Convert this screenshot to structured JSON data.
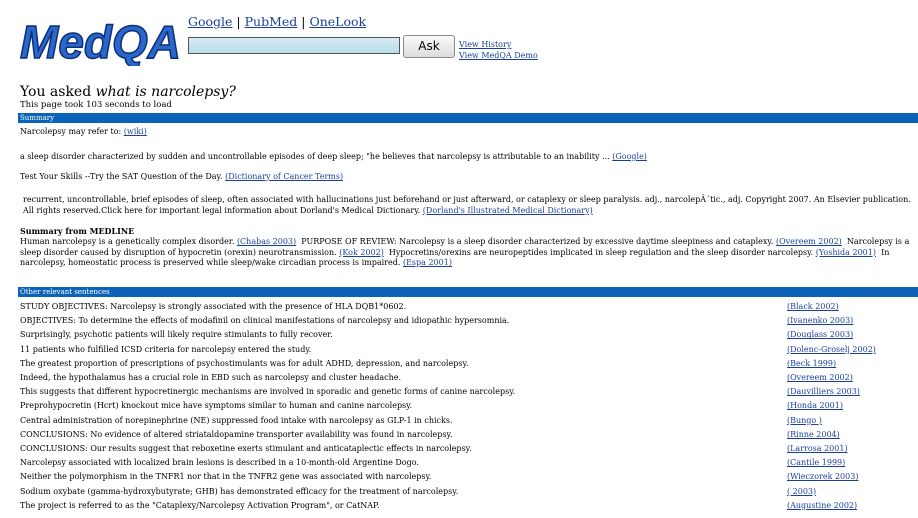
{
  "logo": {
    "text": "MedQA"
  },
  "nav": {
    "links": [
      "Google",
      "PubMed",
      "OneLook"
    ],
    "separator": "|"
  },
  "search": {
    "value": "",
    "ask_label": "Ask"
  },
  "side_links": {
    "history": "View History",
    "demo": "View MedQA Demo"
  },
  "question": {
    "prefix": "You asked",
    "text": "what is narcolepsy?",
    "timing": "This page took 103 seconds to load"
  },
  "summary": {
    "header": "Summary",
    "wiki_text": "Narcolepsy may refer to:",
    "wiki_link": "(wiki)",
    "google_text": "a sleep disorder characterized by sudden and uncontrollable episodes of deep sleep; \"he believes that narcolepsy is attributable to an inability ...",
    "google_link": "(Google)",
    "cancer_text": "Test Your Skills --Try the SAT Question of the Day.",
    "cancer_link": "(Dictionary of Cancer Terms)",
    "dorland_text": "recurrent, uncontrollable, brief episodes of sleep, often associated with hallucinations just beforehand or just afterward, or cataplexy or sleep paralysis. adj., narcolepÂ´tic., adj. Copyright 2007. An Elsevier publication. All rights reserved.Click here for important legal information about Dorland's Medical Dictionary.",
    "dorland_link": "(Dorland's Illustrated Medical Dictionary)",
    "medline_heading": "Summary from MEDLINE",
    "medline": [
      {
        "text": "Human narcolepsy is a genetically complex disorder.",
        "cite": "(Chabas 2003)"
      },
      {
        "text": "PURPOSE OF REVIEW: Narcolepsy is a sleep disorder characterized by excessive daytime sleepiness and cataplexy.",
        "cite": "(Overeem 2002)"
      },
      {
        "text": "Narcolepsy is a sleep disorder caused by disruption of hypocretin (orexin) neurotransmission.",
        "cite": "(Kok 2002)"
      },
      {
        "text": "Hypocretins/orexins are neuropeptides implicated in sleep regulation and the sleep disorder narcolepsy.",
        "cite": "(Yoshida 2001)"
      },
      {
        "text": "In narcolepsy, homeostatic process is preserved while sleep/wake circadian process is impaired.",
        "cite": "(Espa 2001)"
      }
    ]
  },
  "other": {
    "header": "Other relevant sentences",
    "rows": [
      {
        "text": "STUDY OBJECTIVES: Narcolepsy is strongly associated with the presence of HLA DQB1*0602.",
        "cite": "(Black 2002)"
      },
      {
        "text": "OBJECTIVES: To determine the effects of modafinil on clinical manifestations of narcolepsy and idiopathic hypersomnia.",
        "cite": "(Ivanenko 2003)"
      },
      {
        "text": "Surprisingly, psychotic patients will likely require stimulants to fully recover.",
        "cite": "(Douglass 2003)"
      },
      {
        "text": "11 patients who fulfilled ICSD criteria for narcolepsy entered the study.",
        "cite": "(Dolenc-Groselj 2002)"
      },
      {
        "text": "The greatest proportion of prescriptions of psychostimulants was for adult ADHD, depression, and narcolepsy.",
        "cite": "(Beck 1999)"
      },
      {
        "text": "Indeed, the hypothalamus has a crucial role in EBD such as narcolepsy and cluster headache.",
        "cite": "(Overeem 2002)"
      },
      {
        "text": "This suggests that different hypocretinergic mechanisms are involved in sporadic and genetic forms of canine narcolepsy.",
        "cite": "(Dauvilliers 2003)"
      },
      {
        "text": "Preprohypocretin (Hcrt) knockout mice have symptoms similar to human and canine narcolepsy.",
        "cite": "(Honda 2001)"
      },
      {
        "text": "Central administration of norepinephrine (NE) suppressed food intake with narcolepsy as GLP-1 in chicks.",
        "cite": "(Bungo )"
      },
      {
        "text": "CONCLUSIONS: No evidence of altered striataldopamine transporter availability was found in narcolepsy.",
        "cite": "(Rinne 2004)"
      },
      {
        "text": "CONCLUSIONS: Our results suggest that reboxetine exerts stimulant and anticataplectic effects in narcolepsy.",
        "cite": "(Larrosa 2001)"
      },
      {
        "text": "Narcolepsy associated with localized brain lesions is described in a 10-month-old Argentine Dogo.",
        "cite": "(Cantile 1999)"
      },
      {
        "text": "Neither the polymorphism in the TNFR1 nor that in the TNFR2 gene was associated with narcolepsy.",
        "cite": "(Wieczorek 2003)"
      },
      {
        "text": "Sodium oxybate (gamma-hydroxybutyrate; GHB) has demonstrated efficacy for the treatment of narcolepsy.",
        "cite": "( 2003)"
      },
      {
        "text": "The project is referred to as the \"Cataplexy/Narcolepsy Activation Program\", or CatNAP.",
        "cite": "(Augustine 2002)"
      }
    ]
  },
  "colors": {
    "bar": "#0a63b8",
    "link": "#1a3f9c",
    "logo_fill": "#2a67c9"
  }
}
